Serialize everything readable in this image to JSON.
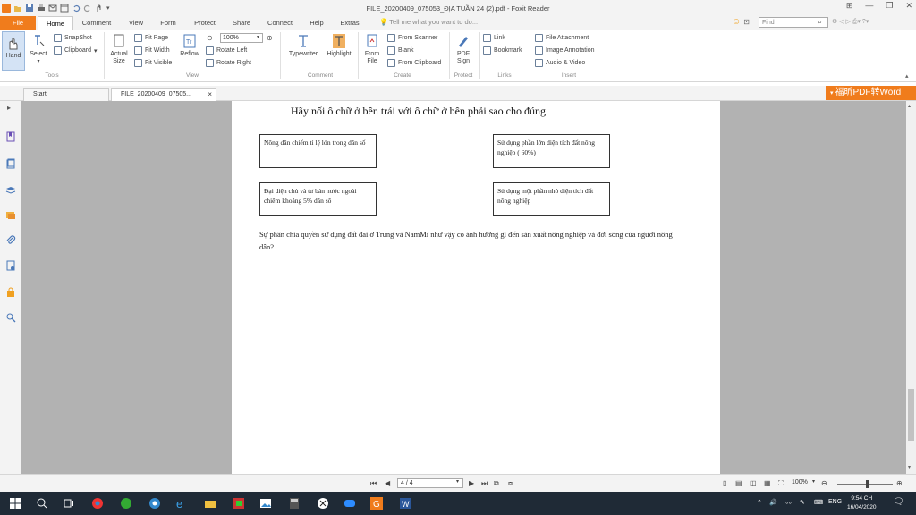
{
  "window": {
    "title": "FILE_20200409_075053_ĐỊA TUẦN 24 (2).pdf - Foxit Reader"
  },
  "menu": {
    "tabs": [
      "File",
      "Home",
      "Comment",
      "View",
      "Form",
      "Protect",
      "Share",
      "Connect",
      "Help",
      "Extras"
    ],
    "active_tab": "Home",
    "tell_me": "Tell me what you want to do...",
    "find_placeholder": "Find"
  },
  "ribbon": {
    "tools": {
      "hand": "Hand",
      "select": "Select",
      "snapshot": "SnapShot",
      "clipboard": "Clipboard",
      "label": "Tools"
    },
    "view": {
      "actual_size_1": "Actual",
      "actual_size_2": "Size",
      "fit_page": "Fit Page",
      "fit_width": "Fit Width",
      "fit_visible": "Fit Visible",
      "reflow": "Reflow",
      "zoom": "100%",
      "rotate_left": "Rotate Left",
      "rotate_right": "Rotate Right",
      "label": "View"
    },
    "comment": {
      "typewriter": "Typewriter",
      "highlight": "Highlight",
      "label": "Comment"
    },
    "create": {
      "from_file_1": "From",
      "from_file_2": "File",
      "from_scanner": "From Scanner",
      "blank": "Blank",
      "from_clipboard": "From Clipboard",
      "label": "Create"
    },
    "protect": {
      "pdf_sign_1": "PDF",
      "pdf_sign_2": "Sign",
      "label": "Protect"
    },
    "links": {
      "link": "Link",
      "bookmark": "Bookmark",
      "label": "Links"
    },
    "insert": {
      "file_attachment": "File Attachment",
      "image_annotation": "Image Annotation",
      "audio_video": "Audio & Video",
      "label": "Insert"
    }
  },
  "doc_tabs": [
    {
      "label": "Start"
    },
    {
      "label": "FILE_20200409_07505..."
    }
  ],
  "promo": "福昕PDF转Word",
  "document": {
    "heading": "Hãy nối ô chữ  ở bên trái với ô chữ ở bên phải sao cho đúng",
    "boxes": {
      "left_top": "Nông dân chiếm tỉ lệ lớn trong dân số",
      "right_top": "Sử dụng phần lớn diện tích đất nông nghiệp ( 60%)",
      "left_bottom": "Đại diện chủ và tư bản nước ngoài chiếm khoảng 5% dân số",
      "right_bottom": "Sử dụng một phần nhỏ diện tích đất nông nghiệp"
    },
    "question": "Sự phân chia quyền sử dụng đất đai ở Trung và NamMĩ như vậy có ảnh hưởng gì đến sản xuất nông nghiệp và đời sống của người nông dân?",
    "dots": "........................................"
  },
  "statusbar": {
    "page": "4 / 4",
    "zoom": "100%"
  },
  "taskbar": {
    "lang": "ENG",
    "time": "9:54 CH",
    "date": "16/04/2020"
  },
  "colors": {
    "accent": "#f07c1c",
    "taskbar": "#1f2a36"
  }
}
